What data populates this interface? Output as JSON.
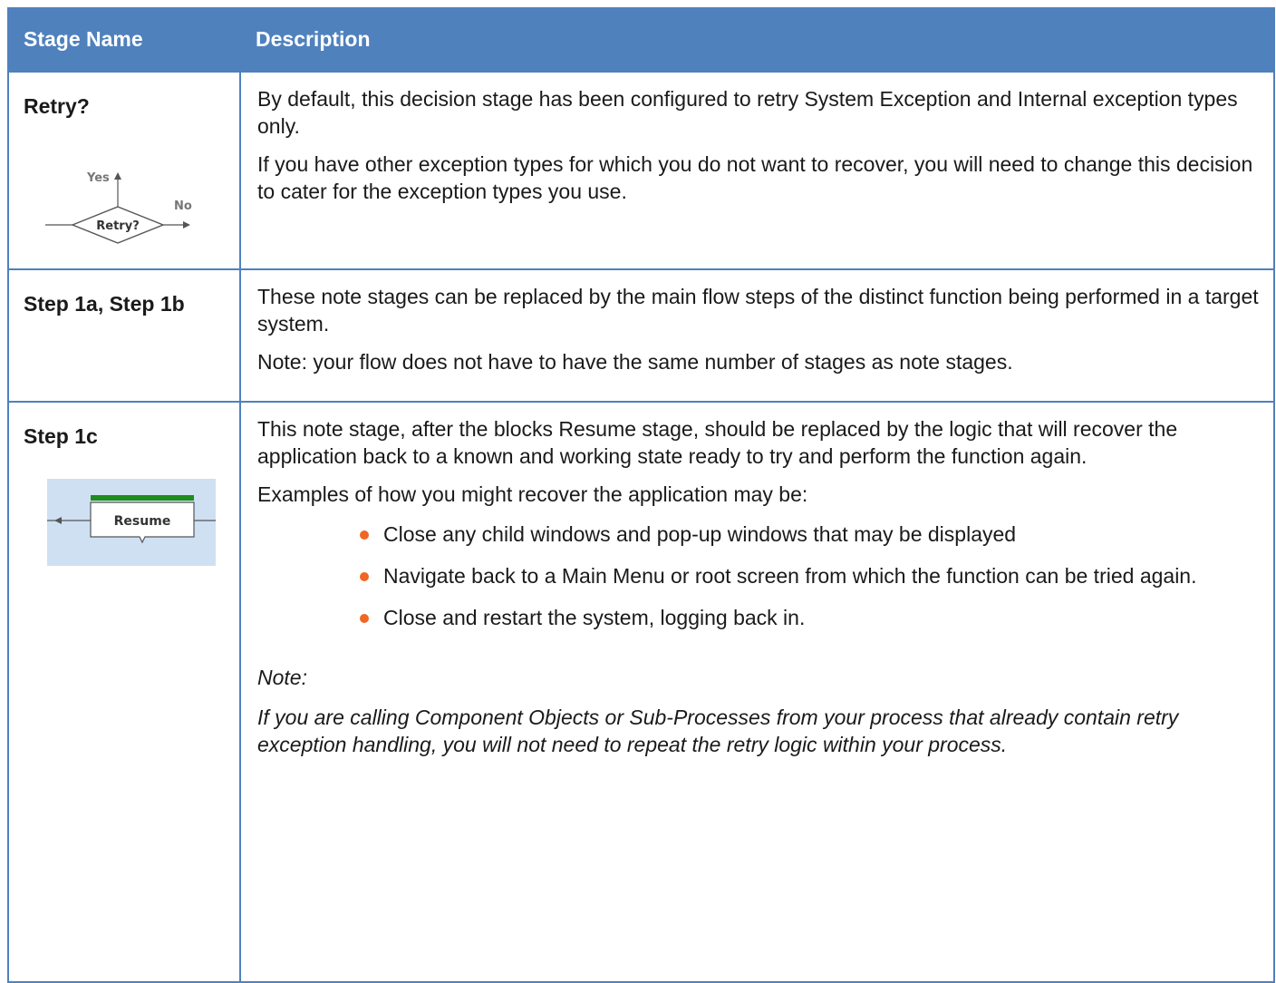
{
  "table": {
    "headers": [
      "Stage Name",
      "Description"
    ],
    "rows": [
      {
        "name": "Retry?",
        "diagram": {
          "type": "decision",
          "label": "Retry?",
          "yes_label": "Yes",
          "no_label": "No"
        },
        "paragraphs": [
          "By default, this decision stage has been configured to retry System Exception and Internal exception types only.",
          "If you have other exception types for which you do not want to recover, you will need to change this decision to cater for the exception types you use."
        ]
      },
      {
        "name": "Step 1a, Step 1b",
        "paragraphs": [
          "These note stages can be replaced by the main flow steps of the distinct function being performed in a target system.",
          "Note: your flow does not have to have the same number of stages as note stages."
        ]
      },
      {
        "name": "Step 1c",
        "diagram": {
          "type": "block",
          "label": "Resume"
        },
        "paragraphs": [
          "This note stage, after the blocks Resume stage, should be replaced by the logic that will recover the application back to a known and working state ready to try and perform the function again.",
          "Examples of how you might recover the application may be:"
        ],
        "bullets": [
          "Close any child windows and pop-up windows that may be displayed",
          "Navigate back to a Main Menu or root screen from which the function can be tried again.",
          "Close and restart the system, logging back in."
        ],
        "note_label": "Note:",
        "note_text": "If you are calling Component Objects or Sub-Processes from your process that already contain retry exception handling, you will not need to repeat the retry logic within your process."
      }
    ]
  },
  "colors": {
    "header_bg": "#4f81bd",
    "border": "#4f81bd",
    "bullet": "#f26522",
    "block_bar": "#1e8c1e",
    "figure_bg": "#cfe0f3"
  },
  "icons": [
    "bullet-icon"
  ]
}
